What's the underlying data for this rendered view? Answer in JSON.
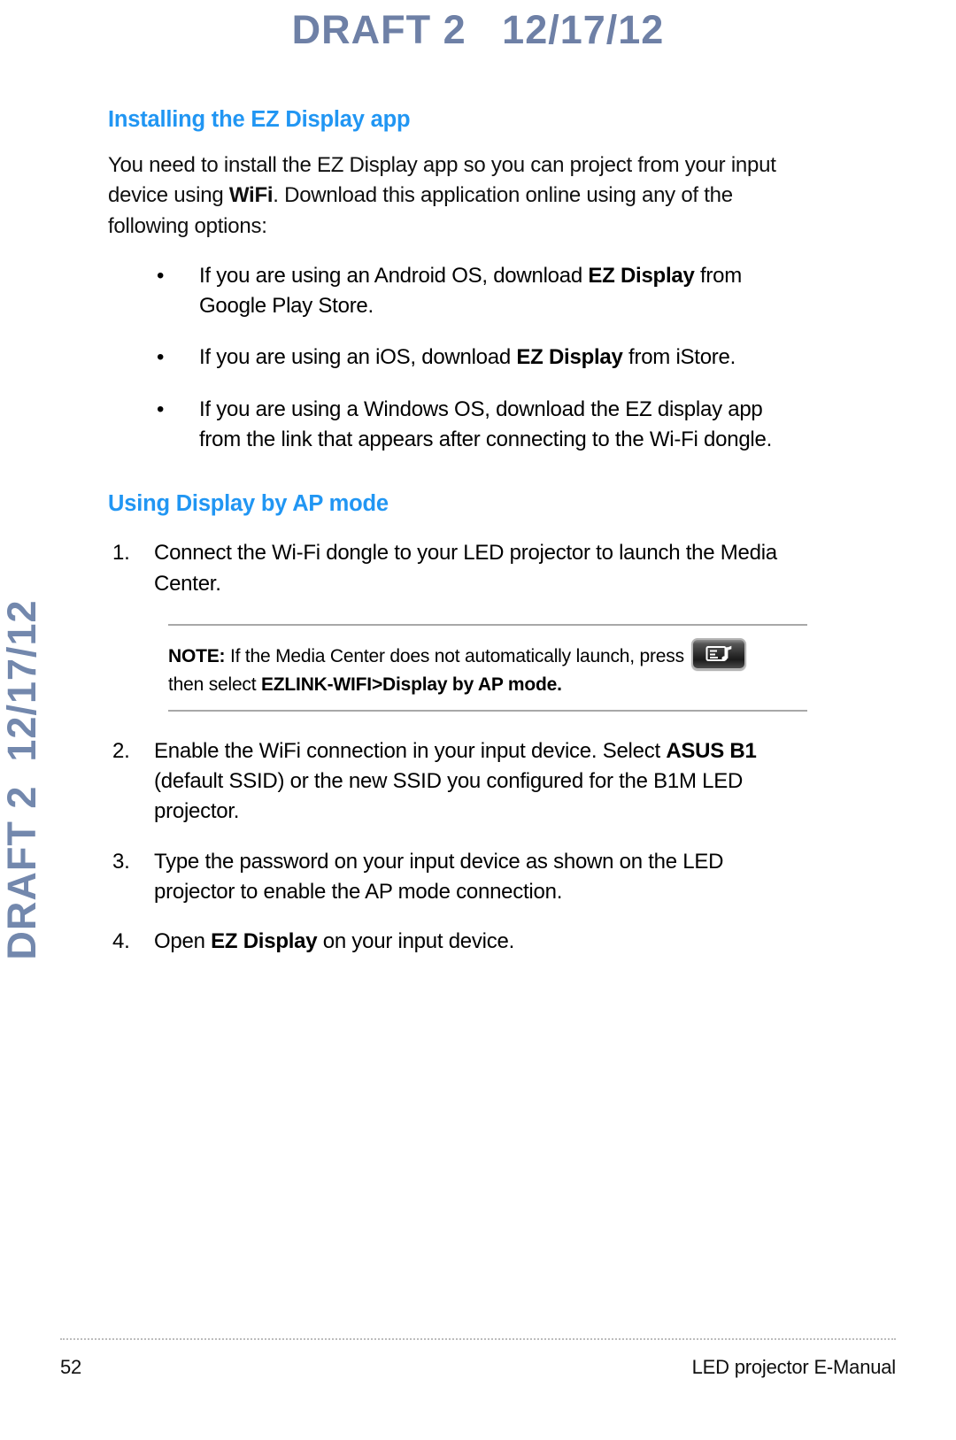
{
  "watermark": {
    "top": "DRAFT 2   12/17/12",
    "side": "DRAFT 2  12/17/12"
  },
  "sections": [
    {
      "heading": "Installing the EZ Display app",
      "intro": {
        "part1": "You need to install the EZ Display app so you can project from your input device using ",
        "bold1": "WiFi",
        "part2": ". Download this application online using any of the following options:"
      },
      "bullet_marker": "•",
      "bullets": [
        {
          "part1": "If you are using an Android OS, download ",
          "bold1": "EZ Display",
          "part2": " from Google Play Store."
        },
        {
          "part1": "If you are using an iOS, download ",
          "bold1": "EZ Display",
          "part2": " from iStore."
        },
        {
          "part1": "If you are using a Windows OS, download the EZ display app from the link that appears after connecting to the Wi-Fi dongle.",
          "bold1": "",
          "part2": ""
        }
      ]
    },
    {
      "heading": "Using Display by AP mode",
      "steps": [
        {
          "number": "1.",
          "part1": "Connect the Wi-Fi dongle to your LED projector to launch the Media Center.",
          "bold1": "",
          "part2": ""
        },
        {
          "number": "2.",
          "part1": "Enable the WiFi connection in your input device. Select ",
          "bold1": "ASUS B1",
          "part2": " (default SSID) or the new SSID you configured for the B1M LED projector."
        },
        {
          "number": "3.",
          "part1": "Type the password on your input device as shown on the LED projector to enable the AP mode connection.",
          "bold1": "",
          "part2": ""
        },
        {
          "number": "4.",
          "part1": "Open ",
          "bold1": "EZ Display",
          "part2": " on your input device."
        }
      ]
    }
  ],
  "note": {
    "label": "NOTE:",
    "text_before_icon": " If the Media Center does not automatically launch, press ",
    "icon_name": "media-center-key-icon",
    "text_after_icon": "then select ",
    "bold_target": "EZLINK-WIFI>Display by AP mode."
  },
  "footer": {
    "page_number": "52",
    "manual_title": "LED projector E-Manual"
  },
  "colors": {
    "heading_blue": "#2196f3",
    "watermark_blue": "#6e80a6",
    "body_black": "#0f0f0f",
    "note_rule": "#a8a8a8"
  }
}
